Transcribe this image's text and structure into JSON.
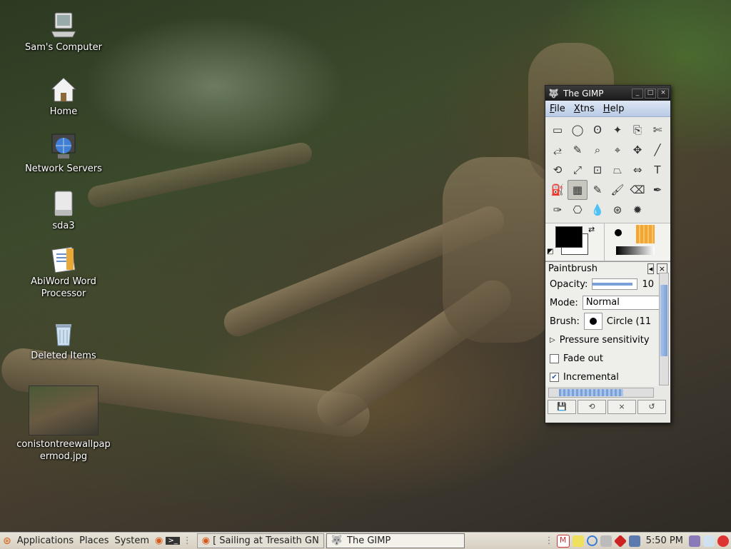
{
  "desktop": {
    "icons": [
      {
        "label": "Sam's Computer",
        "icon": "computer-icon"
      },
      {
        "label": "Home",
        "icon": "home-icon"
      },
      {
        "label": "Network Servers",
        "icon": "network-icon"
      },
      {
        "label": "sda3",
        "icon": "drive-icon"
      },
      {
        "label": "AbiWord Word Processor",
        "icon": "abiword-icon"
      },
      {
        "label": "Deleted Items",
        "icon": "trash-icon"
      },
      {
        "label": "conistontreewallpapermod.jpg",
        "icon": "image-file-icon"
      }
    ]
  },
  "gimp": {
    "title": "The GIMP",
    "window_buttons": [
      "_",
      "□",
      "×"
    ],
    "menu": [
      "File",
      "Xtns",
      "Help"
    ],
    "tools": [
      "▭",
      "◯",
      "ʘ",
      "✦",
      "⎘",
      "✄",
      "⥄",
      "✎",
      "⌕",
      "⌖",
      "✥",
      "╱",
      "⟲",
      "⤢",
      "⊡",
      "⏢",
      "⇔",
      "T",
      "⛽",
      "▦",
      "✎",
      "🖌",
      "⌫",
      "✒",
      "✑",
      "⎔",
      "💧",
      "⊛",
      "✹"
    ],
    "active_tool_index": 19,
    "tool_options": {
      "title": "Paintbrush",
      "opacity_label": "Opacity:",
      "opacity_value": "10",
      "opacity_level": 0.9,
      "mode_label": "Mode:",
      "mode_value": "Normal",
      "brush_label": "Brush:",
      "brush_value": "Circle (11",
      "pressure_label": "Pressure sensitivity",
      "fadeout_label": "Fade out",
      "incremental_label": "Incremental",
      "fadeout_checked": false,
      "incremental_checked": true
    }
  },
  "panel": {
    "applications": "Applications",
    "places": "Places",
    "system": "System",
    "tasks": [
      {
        "label": "[ Sailing at Tresaith GN",
        "active": false
      },
      {
        "label": "The GIMP",
        "active": true
      }
    ],
    "clock": "5:50 PM"
  }
}
